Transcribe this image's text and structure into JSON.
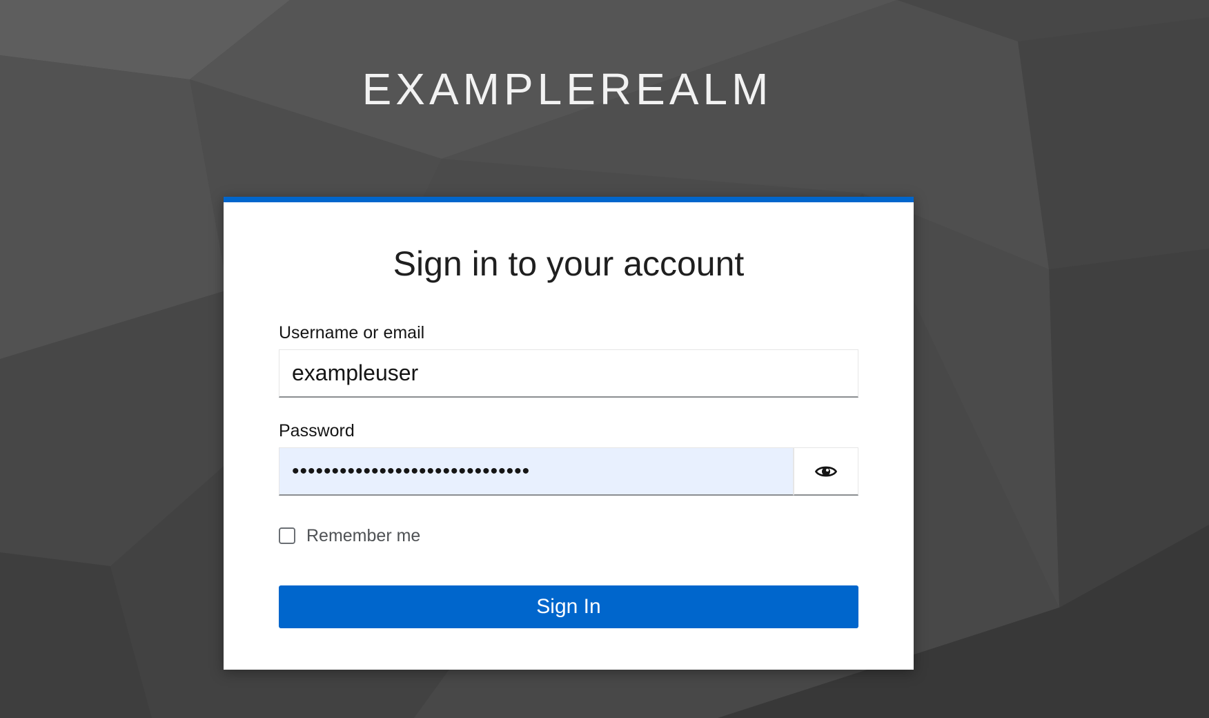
{
  "realm": {
    "title": "EXAMPLEREALM"
  },
  "login": {
    "heading": "Sign in to your account",
    "username_label": "Username or email",
    "username_value": "exampleuser",
    "password_label": "Password",
    "password_value": "••••••••••••••••••••••••••••••",
    "toggle_icon": "eye-icon",
    "remember_label": "Remember me",
    "remember_checked": false,
    "submit_label": "Sign In"
  },
  "colors": {
    "accent": "#0066cc",
    "background": "#4a4a4a",
    "autofill": "#e8f0fe"
  }
}
